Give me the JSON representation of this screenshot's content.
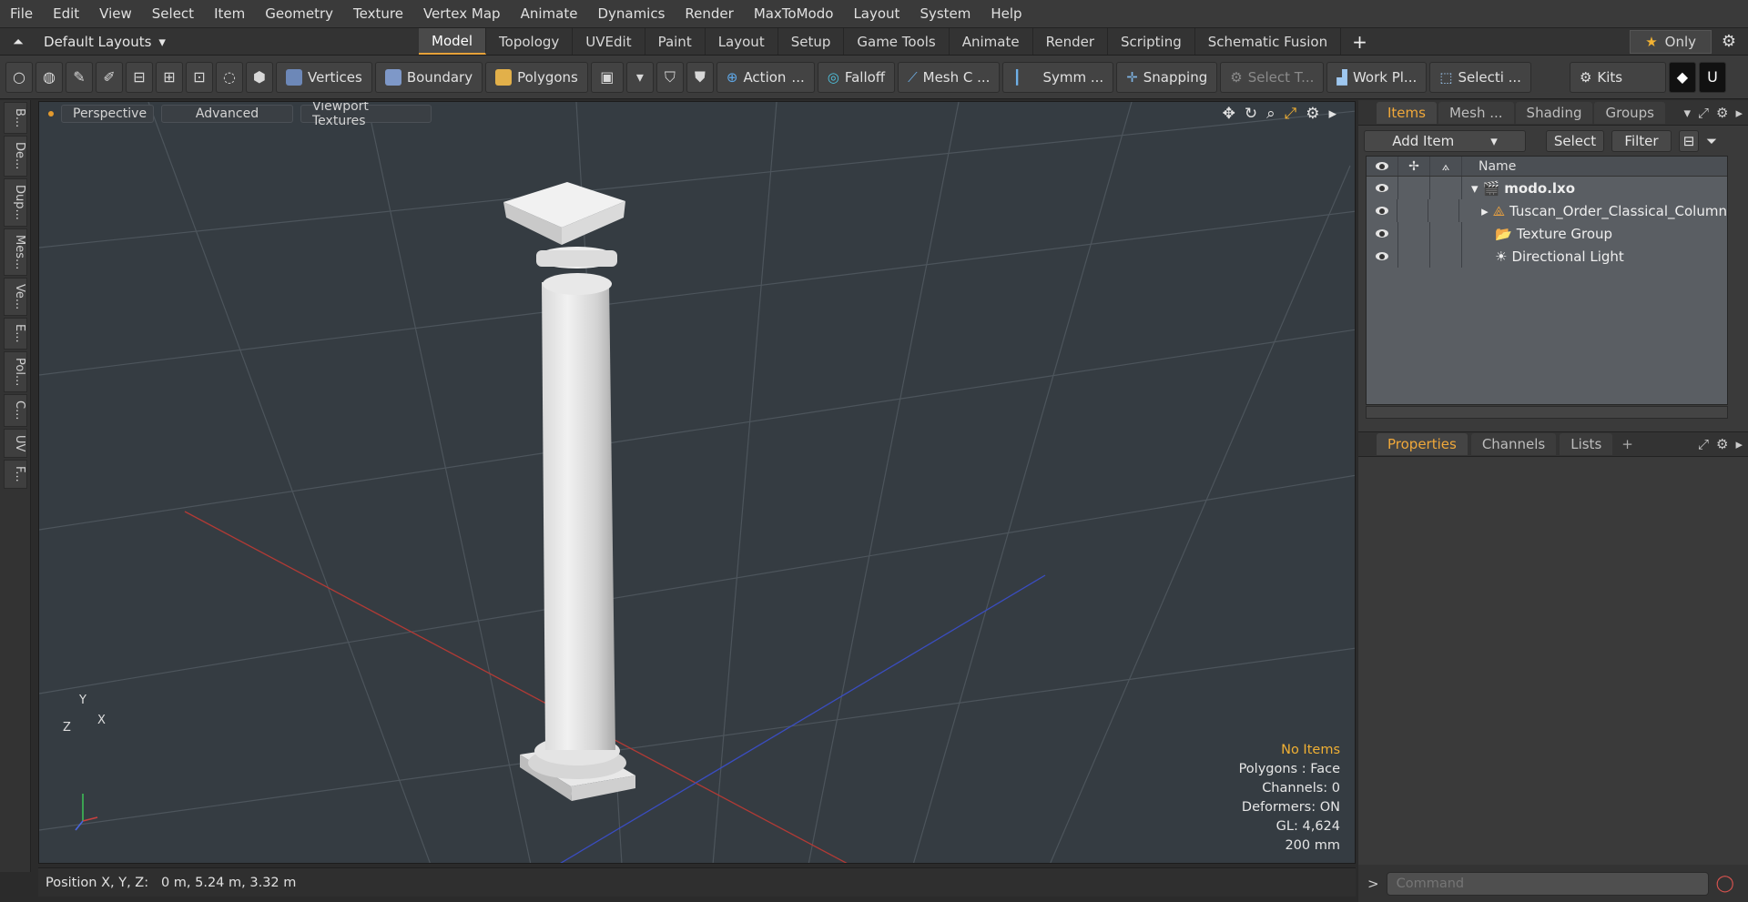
{
  "menu": [
    "File",
    "Edit",
    "View",
    "Select",
    "Item",
    "Geometry",
    "Texture",
    "Vertex Map",
    "Animate",
    "Dynamics",
    "Render",
    "MaxToModo",
    "Layout",
    "System",
    "Help"
  ],
  "layouts": {
    "label": "Default Layouts"
  },
  "tabs": [
    "Model",
    "Topology",
    "UVEdit",
    "Paint",
    "Layout",
    "Setup",
    "Game Tools",
    "Animate",
    "Render",
    "Scripting",
    "Schematic Fusion"
  ],
  "active_tab": "Model",
  "only_label": "Only",
  "toolbar": {
    "vertices": "Vertices",
    "boundary": "Boundary",
    "polygons": "Polygons",
    "action": "Action",
    "action_more": "...",
    "falloff": "Falloff",
    "meshc": "Mesh C ...",
    "symm": "Symm ...",
    "snapping": "Snapping",
    "selectt": "Select T...",
    "workpl": "Work Pl...",
    "selecti": "Selecti ...",
    "kits": "Kits"
  },
  "left_tabs": [
    "B...",
    "De...",
    "Dup...",
    "Mes...",
    "Ve...",
    "E...",
    "Pol...",
    "C...",
    "UV",
    "F..."
  ],
  "viewport": {
    "tabs": [
      "Perspective",
      "Advanced",
      "Viewport Textures"
    ],
    "info": {
      "line1": "No Items",
      "line2": "Polygons : Face",
      "line3": "Channels: 0",
      "line4": "Deformers: ON",
      "line5": "GL: 4,624",
      "line6": "200 mm"
    },
    "axis": {
      "y": "Y",
      "x": "X",
      "z": "Z"
    }
  },
  "status": "Position X, Y, Z:   0 m, 5.24 m, 3.32 m",
  "right_panel": {
    "tabs": [
      "Items",
      "Mesh ...",
      "Shading",
      "Groups"
    ],
    "add_item": "Add Item",
    "select": "Select",
    "filter": "Filter",
    "col_name": "Name",
    "tree": [
      {
        "label": "modo.lxo",
        "level": 0
      },
      {
        "label": "Tuscan_Order_Classical_Column",
        "level": 1
      },
      {
        "label": "Texture Group",
        "level": 1
      },
      {
        "label": "Directional Light",
        "level": 1
      }
    ],
    "props_tabs": [
      "Properties",
      "Channels",
      "Lists"
    ],
    "command_placeholder": "Command"
  }
}
